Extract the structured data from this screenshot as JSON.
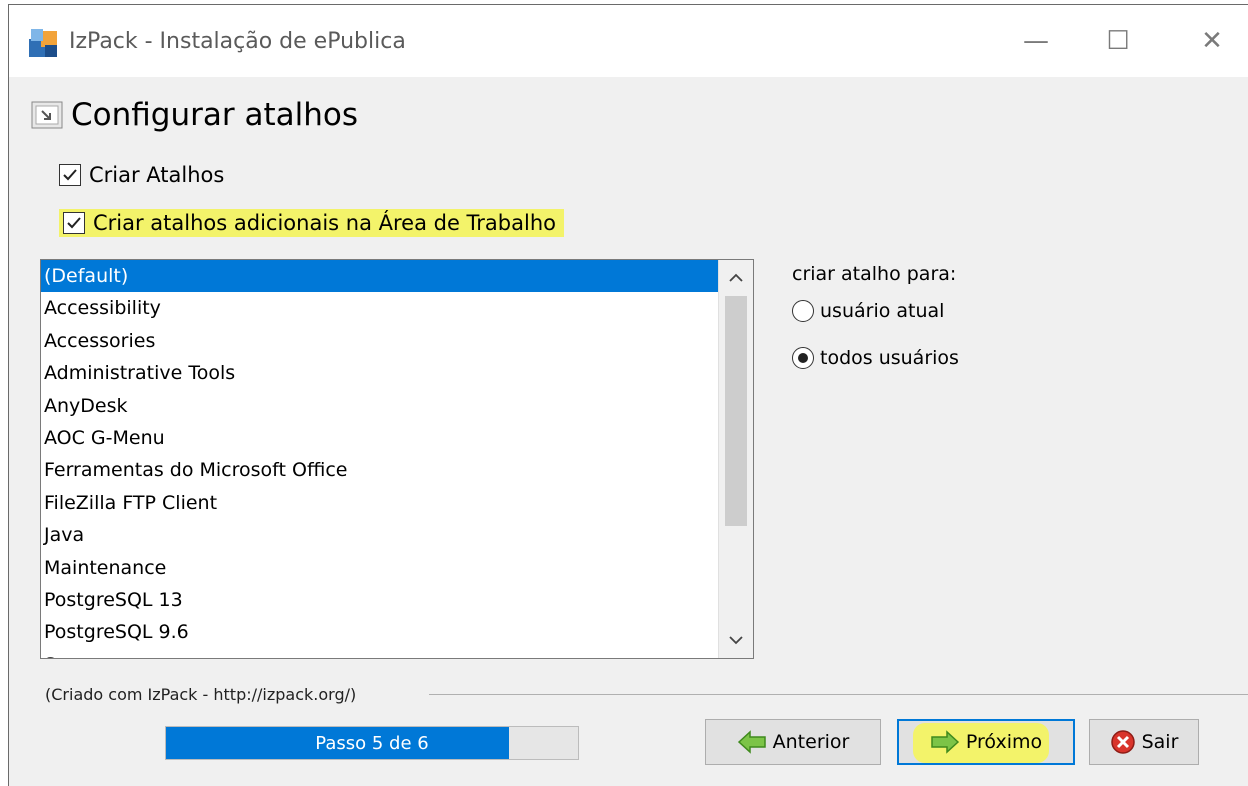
{
  "window": {
    "title": "IzPack - Instalação de  ePublica",
    "controls": {
      "minimize": "—",
      "maximize": "☐",
      "close": "✕"
    }
  },
  "page": {
    "title": "Configurar atalhos"
  },
  "options": {
    "create_shortcuts": {
      "label": "Criar Atalhos",
      "checked": true
    },
    "desktop_shortcuts": {
      "label": "Criar atalhos adicionais na Área de Trabalho",
      "checked": true,
      "highlight_color": "#f3f36a"
    }
  },
  "program_group_list": {
    "items": [
      "(Default)",
      "Accessibility",
      "Accessories",
      "Administrative Tools",
      "AnyDesk",
      "AOC G-Menu",
      "Ferramentas do Microsoft Office",
      "FileZilla FTP Client",
      "Java",
      "Maintenance",
      "PostgreSQL 13",
      "PostgreSQL 9.6",
      "Screen+"
    ],
    "selected": "(Default)",
    "selection_color": "#0078d7"
  },
  "shortcut_target": {
    "label": "criar atalho para:",
    "options": [
      "usuário atual",
      "todos usuários"
    ],
    "selected": "todos usuários"
  },
  "footer": {
    "credit": "(Criado com IzPack - http://izpack.org/)",
    "progress": {
      "text": "Passo 5 de 6",
      "current": 5,
      "total": 6
    },
    "buttons": {
      "previous": "Anterior",
      "next": "Próximo",
      "exit": "Sair"
    }
  },
  "icons": {
    "app": "izpack-app-icon",
    "page": "shortcut-page-icon",
    "previous": "green-arrow-left-icon",
    "next": "green-arrow-right-icon",
    "exit": "red-x-icon"
  }
}
